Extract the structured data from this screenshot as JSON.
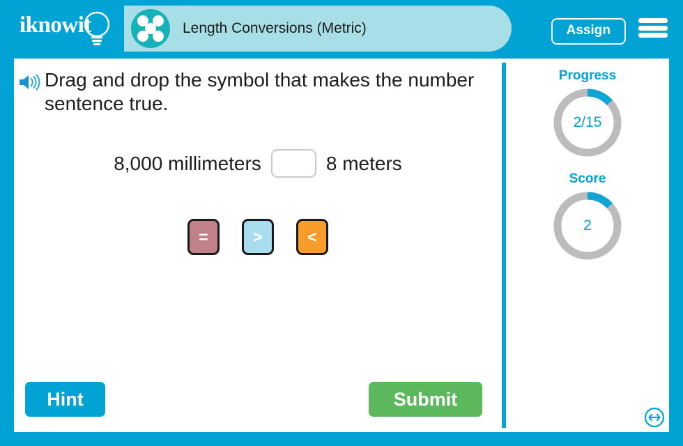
{
  "header": {
    "logo_text": "iknowit",
    "logo_icon": "lightbulb-icon",
    "title": "Length Conversions (Metric)",
    "title_badge_icon": "five-dots-icon",
    "assign_label": "Assign",
    "menu_icon": "hamburger-menu-icon"
  },
  "question": {
    "audio_icon": "speaker-icon",
    "text": "Drag and drop the symbol that makes the number sentence true."
  },
  "sentence": {
    "left": "8,000 millimeters",
    "blank_value": "",
    "right": "8 meters"
  },
  "tiles": [
    {
      "symbol": "=",
      "color": "#c08288",
      "name": "tile-equals"
    },
    {
      "symbol": ">",
      "color": "#a8dcee",
      "name": "tile-greater-than"
    },
    {
      "symbol": "<",
      "color": "#f89c2c",
      "name": "tile-less-than"
    }
  ],
  "sidebar": {
    "progress": {
      "label": "Progress",
      "value_text": "2/15",
      "current": 2,
      "total": 15,
      "percent": 13.3
    },
    "score": {
      "label": "Score",
      "value_text": "2",
      "current": 2,
      "percent": 13.3
    }
  },
  "actions": {
    "hint_label": "Hint",
    "submit_label": "Submit",
    "resize_icon": "resize-horizontal-icon"
  },
  "colors": {
    "brand_blue": "#00a3d3",
    "title_pill": "#a8dfe6",
    "badge_teal": "#17b2b8",
    "submit_green": "#5cb85c",
    "gauge_track": "#bcbcbc",
    "gauge_fill": "#11a5d6"
  }
}
